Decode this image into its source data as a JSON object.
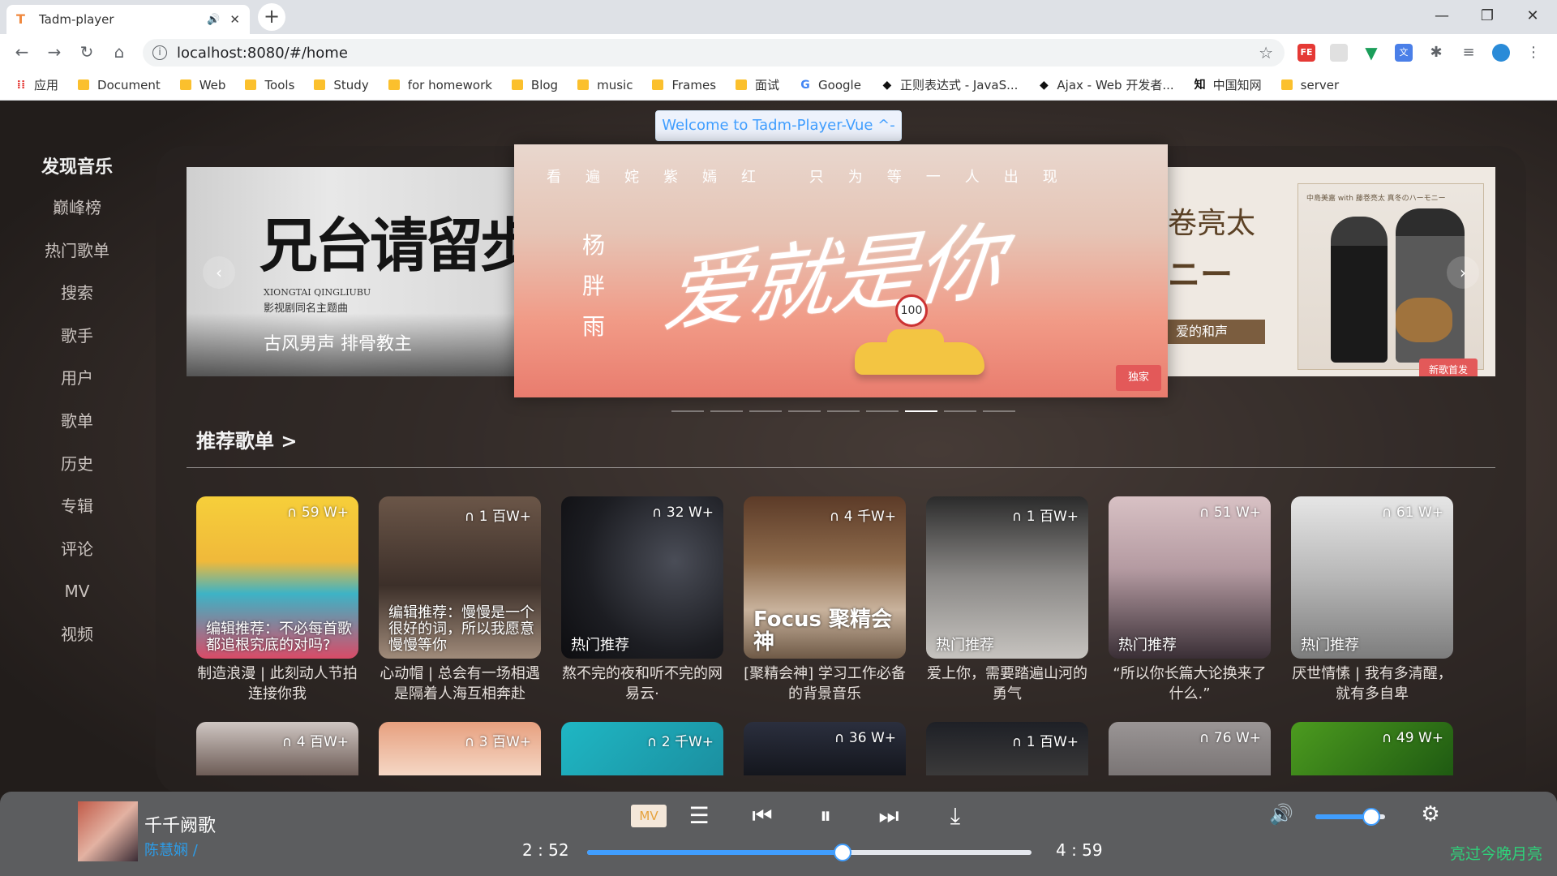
{
  "browser": {
    "tab_title": "Tadm-player",
    "url": "localhost:8080/#/home",
    "bookmarks": [
      "应用",
      "Document",
      "Web",
      "Tools",
      "Study",
      "for homework",
      "Blog",
      "music",
      "Frames",
      "面试",
      "Google",
      "正则表达式 - JavaS...",
      "Ajax - Web 开发者...",
      "中国知网",
      "server"
    ]
  },
  "app": {
    "welcome": "Welcome to Tadm-Player-Vue ^-^",
    "sidebar": {
      "title": "发现音乐",
      "items": [
        "巅峰榜",
        "热门歌单",
        "搜索",
        "歌手",
        "用户",
        "歌单",
        "历史",
        "专辑",
        "评论",
        "MV",
        "视频"
      ]
    },
    "carousel": {
      "left": {
        "big": "兄台请留步",
        "en": "XIONGTAI QINGLIUBU",
        "sub": "影视剧同名主题曲",
        "bottom": "古风男声 排骨教主"
      },
      "center": {
        "top": "看遍姹紫嫣红 只为等一人出现",
        "name": "杨胖雨",
        "title": "爱就是你",
        "sign": "100",
        "badge": "独家"
      },
      "right": {
        "a": "卷亮太",
        "b": "ニー",
        "c": "爱的和声",
        "small": "中島美嘉 with 藤巻亮太 真冬のハーモニー",
        "badge": "新歌首发"
      },
      "prev": "‹",
      "next": "›",
      "active_index": 6
    },
    "section_title": "推荐歌单 >",
    "playlists": [
      {
        "plays": "59 W+",
        "tag": "编辑推荐：不必每首歌都追根究底的对吗?",
        "name": "制造浪漫 | 此刻动人节拍连接你我"
      },
      {
        "plays": "1 百W+",
        "tag": "编辑推荐：慢慢是一个很好的词，所以我愿意慢慢等你",
        "name": "心动帽 | 总会有一场相遇是隔着人海互相奔赴"
      },
      {
        "plays": "32 W+",
        "tag": "热门推荐",
        "name": "熬不完的夜和听不完的网易云·"
      },
      {
        "plays": "4 千W+",
        "tag": "Focus 聚精会神",
        "name": "[聚精会神] 学习工作必备的背景音乐"
      },
      {
        "plays": "1 百W+",
        "tag": "热门推荐",
        "name": "爱上你，需要踏遍山河的勇气"
      },
      {
        "plays": "51 W+",
        "tag": "热门推荐",
        "name": "“所以你长篇大论换来了什么.”"
      },
      {
        "plays": "61 W+",
        "tag": "热门推荐",
        "name": "厌世情愫 | 我有多清醒，就有多自卑"
      }
    ],
    "playlists_row2": [
      "4 百W+",
      "3 百W+",
      "2 千W+",
      "36 W+",
      "1 百W+",
      "76 W+",
      "49 W+"
    ]
  },
  "player": {
    "song": "千千阙歌",
    "artist": "陈慧娴 /",
    "mv": "MV",
    "current": "2 : 52",
    "duration": "4 : 59",
    "progress": 0.575,
    "volume": 0.8,
    "next_song": "亮过今晚月亮"
  }
}
